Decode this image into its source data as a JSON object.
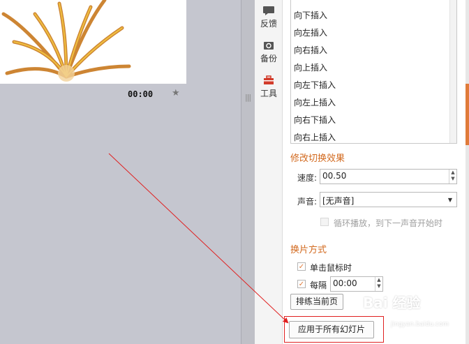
{
  "slide": {
    "time": "00:00",
    "star_icon": "star-icon"
  },
  "sidebar": {
    "items": [
      {
        "label": "反馈",
        "icon": "chat-bubble-icon"
      },
      {
        "label": "备份",
        "icon": "backup-icon"
      },
      {
        "label": "工具",
        "icon": "toolbox-icon"
      }
    ]
  },
  "scheme_list": {
    "items": [
      "向下插入",
      "向左插入",
      "向右插入",
      "向上插入",
      "向左下插入",
      "向左上插入",
      "向右下插入",
      "向右上插入"
    ]
  },
  "modify": {
    "title": "修改切换效果",
    "speed_label": "速度:",
    "speed_value": "00.50",
    "sound_label": "声音:",
    "sound_value": "[无声音]",
    "loop_label": "循环播放，到下一声音开始时"
  },
  "advance": {
    "title": "换片方式",
    "on_click_label": "单击鼠标时",
    "every_label": "每隔",
    "every_value": "00:00",
    "preview_button": "排练当前页"
  },
  "apply_all_button": "应用于所有幻灯片",
  "watermark": {
    "text": "Bai 经验",
    "sub": "jingyan.baidu.com"
  },
  "colors": {
    "accent": "#d2691e",
    "annotation": "#e02020",
    "canvas": "#c5c6cf"
  }
}
